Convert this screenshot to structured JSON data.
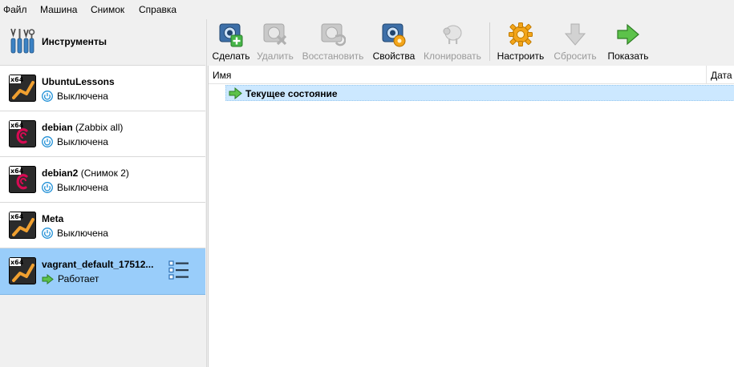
{
  "menu": [
    "Файл",
    "Машина",
    "Снимок",
    "Справка"
  ],
  "tools": {
    "label": "Инструменты"
  },
  "vms": [
    {
      "name": "UbuntuLessons",
      "sub": "",
      "state": "Выключена"
    },
    {
      "name": "debian",
      "sub": " (Zabbix all)",
      "state": "Выключена"
    },
    {
      "name": "debian2",
      "sub": " (Снимок 2)",
      "state": "Выключена"
    },
    {
      "name": "Meta",
      "sub": "",
      "state": "Выключена"
    },
    {
      "name": "vagrant_default_17512...",
      "sub": "",
      "state": "Работает"
    }
  ],
  "os_badge": "x64",
  "toolbar": {
    "take": "Сделать",
    "delete": "Удалить",
    "restore": "Восстановить",
    "properties": "Свойства",
    "clone": "Клонировать",
    "settings": "Настроить",
    "discard": "Сбросить",
    "show": "Показать"
  },
  "table": {
    "col_name": "Имя",
    "col_date": "Дата с",
    "rows": [
      {
        "label": "Текущее состояние"
      }
    ]
  },
  "colors": {
    "selected_vm": "#99cdfa",
    "selected_row": "#cce8ff",
    "power_off": "#1f8fd6",
    "running": "#3fae3f"
  }
}
